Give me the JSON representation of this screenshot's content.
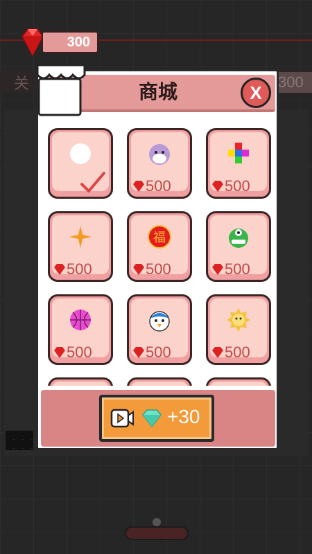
{
  "hud": {
    "gems": "300",
    "level_label": "关",
    "level_score": "300"
  },
  "shop": {
    "title": "商城",
    "close_label": "X",
    "items": [
      {
        "art": "white-ball",
        "price": "",
        "owned": true
      },
      {
        "art": "seal-face",
        "price": "500",
        "owned": false
      },
      {
        "art": "color-blocks",
        "price": "500",
        "owned": false
      },
      {
        "art": "four-point-star",
        "price": "500",
        "owned": false
      },
      {
        "art": "fu-coin",
        "price": "500",
        "owned": false
      },
      {
        "art": "green-monster",
        "price": "500",
        "owned": false
      },
      {
        "art": "basketball",
        "price": "500",
        "owned": false
      },
      {
        "art": "penguin-face",
        "price": "500",
        "owned": false
      },
      {
        "art": "sun-lion",
        "price": "500",
        "owned": false
      }
    ],
    "reward_button": {
      "label": "+30",
      "icon": "video-icon"
    }
  },
  "colors": {
    "accent": "#e59a9a",
    "button": "#f39a3a",
    "price": "#c04848"
  }
}
